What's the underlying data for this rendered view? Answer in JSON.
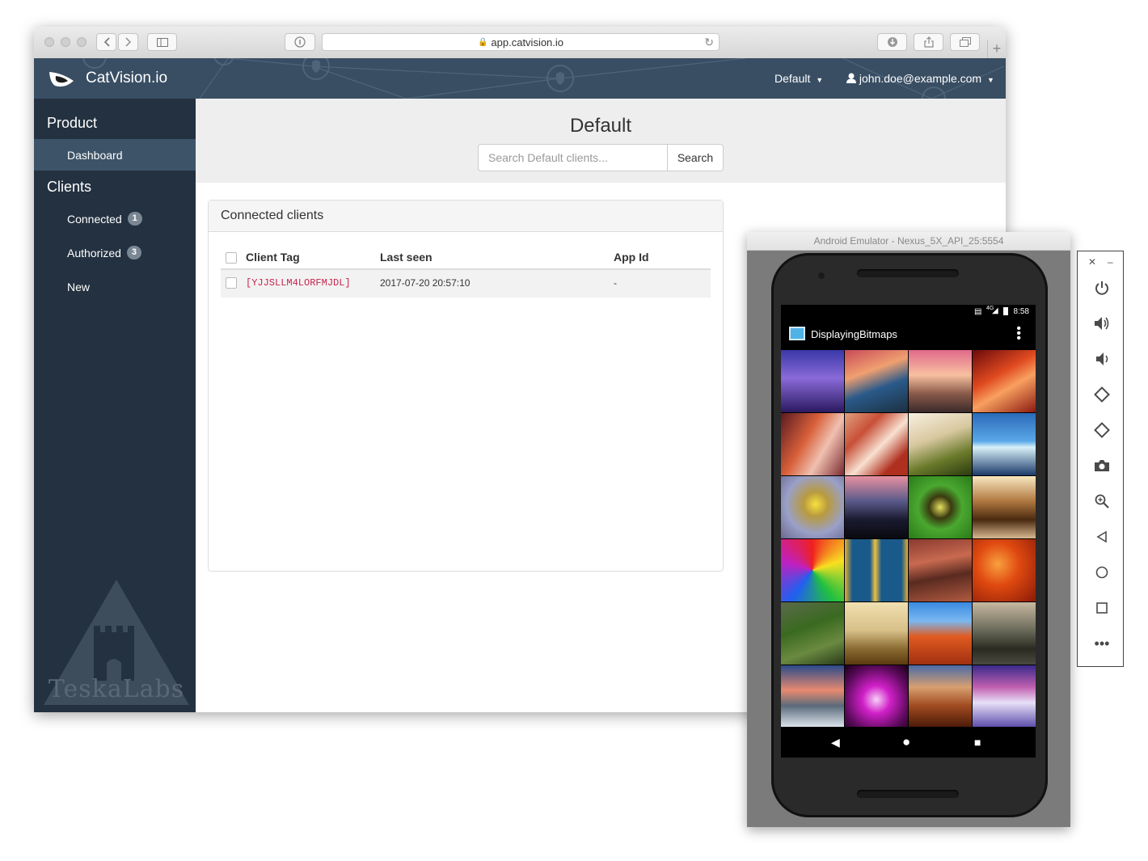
{
  "browser": {
    "url": "app.catvision.io"
  },
  "header": {
    "brand": "CatVision.io",
    "domain_menu": "Default",
    "user_menu": "john.doe@example.com"
  },
  "sidebar": {
    "section_product": "Product",
    "dashboard": "Dashboard",
    "section_clients": "Clients",
    "connected": "Connected",
    "connected_count": "1",
    "authorized": "Authorized",
    "authorized_count": "3",
    "new": "New",
    "logo_text": "TeskaLabs"
  },
  "main": {
    "title": "Default",
    "search_placeholder": "Search Default clients...",
    "search_button": "Search",
    "panel_title": "Connected clients",
    "columns": [
      "Client Tag",
      "Last seen",
      "App Id"
    ],
    "rows": [
      {
        "client_tag": "[YJJSLLM4LORFMJDL]",
        "last_seen": "2017-07-20 20:57:10",
        "app_id": "-"
      }
    ]
  },
  "emulator": {
    "window_title": "Android Emulator - Nexus_5X_API_25:5554",
    "status_time": "8:58",
    "status_network": "4G",
    "app_title": "DisplayingBitmaps"
  },
  "colors": {
    "header_bg": "#394e63",
    "sidebar_bg": "#233140",
    "sidebar_active": "#3d5368",
    "tag_color": "#c7254e"
  },
  "emulator_controls": [
    "close-icon",
    "minimize-icon",
    "power-icon",
    "volume-up-icon",
    "volume-down-icon",
    "rotate-left-icon",
    "rotate-right-icon",
    "camera-icon",
    "zoom-icon",
    "back-icon",
    "home-icon",
    "overview-icon",
    "more-icon"
  ]
}
